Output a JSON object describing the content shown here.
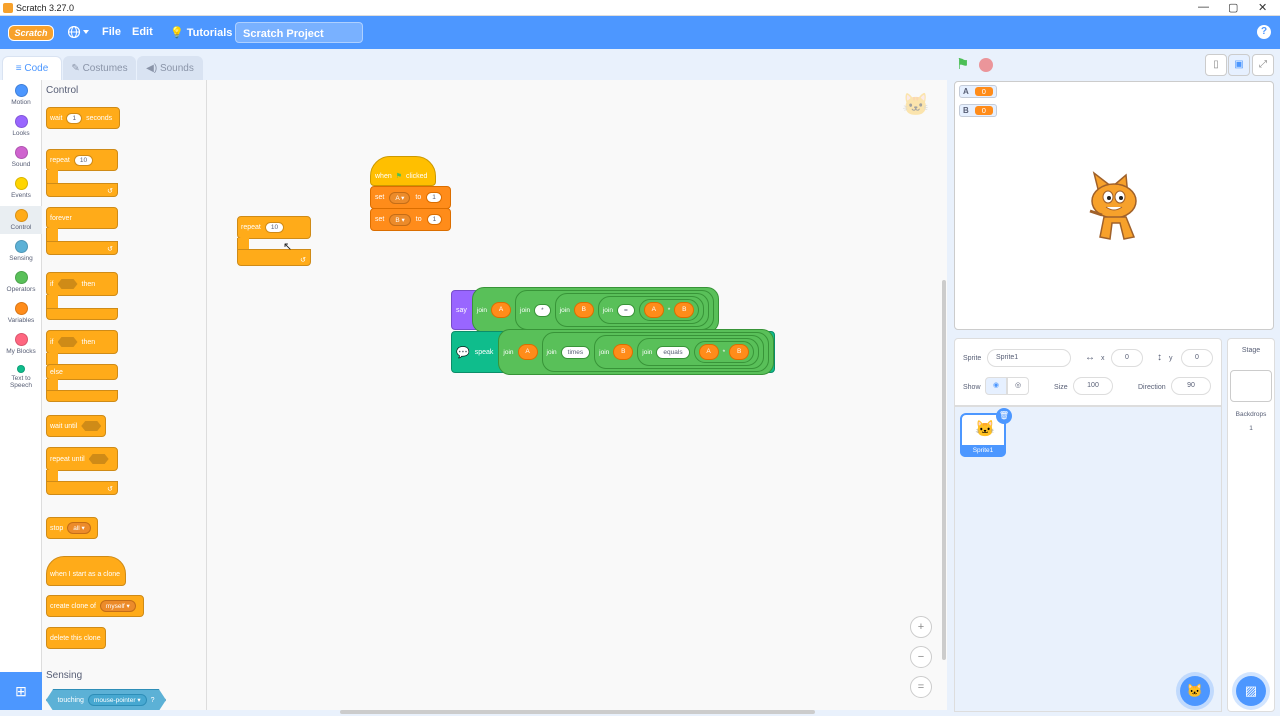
{
  "window": {
    "title": "Scratch 3.27.0",
    "controls": [
      "—",
      "▢",
      "✕"
    ]
  },
  "menubar": {
    "logo": "Scratch",
    "file": "File",
    "edit": "Edit",
    "tutorials": "Tutorials",
    "project_title": "Scratch Project",
    "help": "?"
  },
  "tabs": {
    "code": "Code",
    "costumes": "Costumes",
    "sounds": "Sounds"
  },
  "categories": [
    {
      "label": "Motion",
      "color": "#4c97ff"
    },
    {
      "label": "Looks",
      "color": "#9966ff"
    },
    {
      "label": "Sound",
      "color": "#cf63cf"
    },
    {
      "label": "Events",
      "color": "#ffd500"
    },
    {
      "label": "Control",
      "color": "#ffab19"
    },
    {
      "label": "Sensing",
      "color": "#5cb1d6"
    },
    {
      "label": "Operators",
      "color": "#59c059"
    },
    {
      "label": "Variables",
      "color": "#ff8c1a"
    },
    {
      "label": "My Blocks",
      "color": "#ff6680"
    },
    {
      "label": "Text to Speech",
      "color": "#0fbd8c"
    }
  ],
  "palette": {
    "heading_control": "Control",
    "wait": "wait",
    "wait_val": "1",
    "seconds": "seconds",
    "repeat": "repeat",
    "repeat_val": "10",
    "forever": "forever",
    "if": "if",
    "then": "then",
    "if2": "if",
    "then2": "then",
    "else": "else",
    "wait_until": "wait until",
    "repeat_until": "repeat until",
    "stop": "stop",
    "stop_val": "all",
    "when_clone": "when I start as a clone",
    "create_clone": "create clone of",
    "create_clone_val": "myself",
    "delete_clone": "delete this clone",
    "heading_sensing": "Sensing",
    "touching": "touching",
    "touching_val": "mouse-pointer",
    "touching_q": "?"
  },
  "script": {
    "repeat": "repeat",
    "repeat_val": "10",
    "when": "when",
    "clicked": "clicked",
    "set1": "set",
    "set1_var": "A",
    "to1": "to",
    "set1_val": "1",
    "set2": "set",
    "set2_var": "B",
    "to2": "to",
    "set2_val": "1",
    "say": "say",
    "say_join1": "join",
    "say_a": "A",
    "say_join2": "join",
    "say_str1": "*",
    "say_join3": "join",
    "say_b": "B",
    "say_join4": "join",
    "say_str2": "=",
    "say_a2": "A",
    "say_op": "*",
    "say_b2": "B",
    "speak": "speak",
    "sp_join1": "join",
    "sp_a": "A",
    "sp_join2": "join",
    "sp_str1": "times",
    "sp_join3": "join",
    "sp_b": "B",
    "sp_join4": "join",
    "sp_str2": "equals",
    "sp_a2": "A",
    "sp_op": "*",
    "sp_b2": "B"
  },
  "zoom": {
    "in": "+",
    "out": "−",
    "reset": "="
  },
  "stage": {
    "monitors": [
      {
        "name": "A",
        "value": "0"
      },
      {
        "name": "B",
        "value": "0"
      }
    ]
  },
  "sprite_info": {
    "sprite_label": "Sprite",
    "sprite_name": "Sprite1",
    "x_label": "x",
    "x_val": "0",
    "y_label": "y",
    "y_val": "0",
    "show_label": "Show",
    "size_label": "Size",
    "size_val": "100",
    "direction_label": "Direction",
    "direction_val": "90"
  },
  "sprites": [
    {
      "name": "Sprite1"
    }
  ],
  "stage_panel": {
    "title": "Stage",
    "backdrops_label": "Backdrops",
    "backdrops_count": "1"
  }
}
